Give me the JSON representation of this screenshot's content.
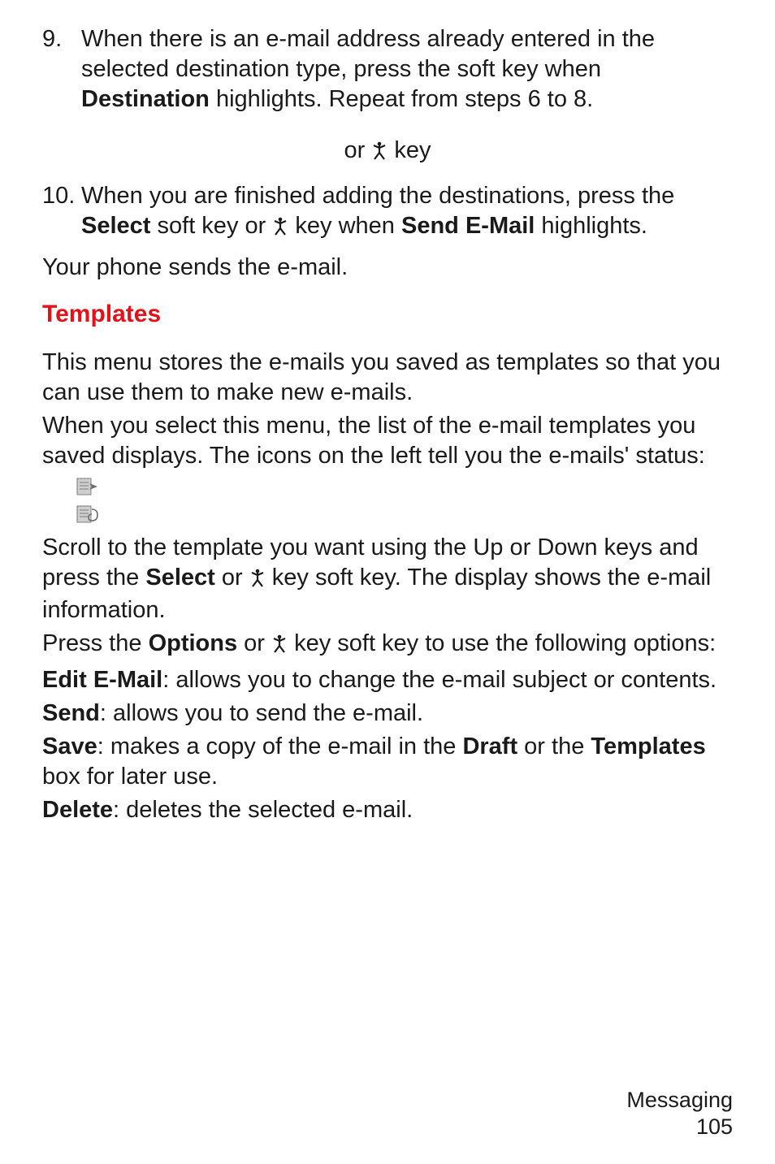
{
  "step9": {
    "num": "9.",
    "text_a": "When there is an e-mail address already entered in the selected destination type, press the ",
    "text_b": " soft key when ",
    "bold_dest": "Destination",
    "text_c": " highlights. Repeat from steps 6 to 8."
  },
  "center": {
    "text_a": "or ",
    "text_b": " key"
  },
  "step10": {
    "num": "10.",
    "text_a": "When you are finished adding the destinations, press the ",
    "bold_select": "Select",
    "text_b": " soft key or ",
    "text_c": " key when ",
    "bold_send": "Send E-Mail",
    "text_d": " highlights."
  },
  "sends_para": "Your phone sends the e-mail.",
  "templates_heading": "Templates",
  "templates_intro_a": "This menu stores the e-mails you saved as templates so that you can use them to make new e-mails.",
  "templates_intro_b": "When you select this menu, the list of the e-mail templates you saved displays. The icons on the left tell you the e-mails' status:",
  "scroll_para": {
    "text_a": "Scroll to the template you want using the Up or Down keys and press the ",
    "bold_select": "Select",
    "text_b": " or ",
    "text_c": " key soft key. The display shows the e-mail information."
  },
  "press_para": {
    "text_a": "Press the ",
    "bold_options": "Options",
    "text_b": " or ",
    "text_c": " key soft key to use the following options:"
  },
  "opt_edit": {
    "bold": "Edit E-Mail",
    "text": ": allows you to change the e-mail subject or contents."
  },
  "opt_send": {
    "bold": "Send",
    "text": ": allows you to send the e-mail."
  },
  "opt_save": {
    "bold_a": "Save",
    "text_a": ": makes a copy of the e-mail in the ",
    "bold_b": "Draft",
    "text_b": " or the ",
    "bold_c": "Templates",
    "text_c": " box for later use."
  },
  "opt_delete": {
    "bold": "Delete",
    "text": ": deletes the selected e-mail."
  },
  "footer": {
    "section": "Messaging",
    "page": "105"
  },
  "icons": {
    "key": "center-key-icon",
    "doc_send": "document-send-icon",
    "doc_attach": "document-attachment-icon"
  }
}
